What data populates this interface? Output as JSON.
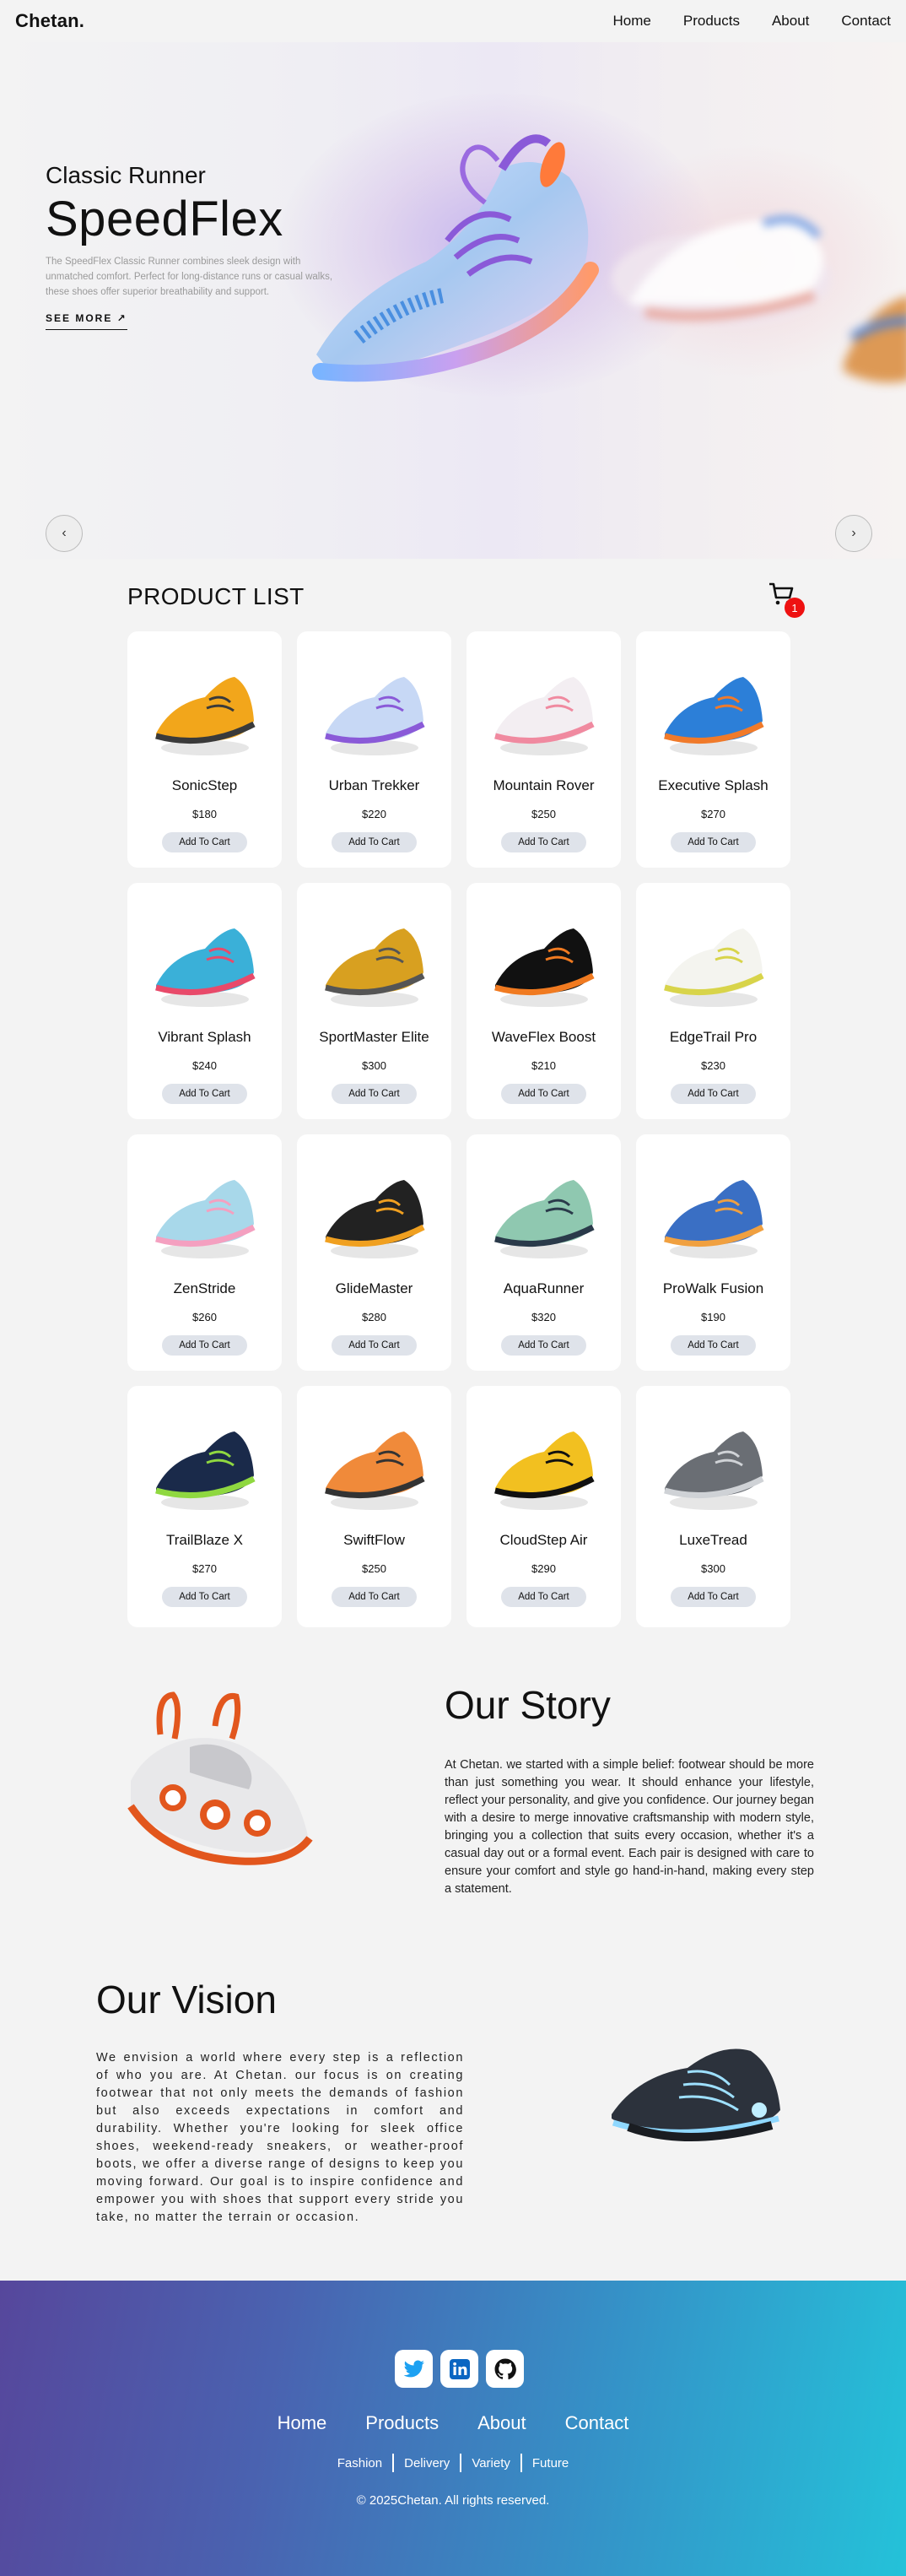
{
  "header": {
    "brand": "Chetan.",
    "nav": [
      "Home",
      "Products",
      "About",
      "Contact"
    ]
  },
  "hero": {
    "subtitle": "Classic Runner",
    "title": "SpeedFlex",
    "description": "The SpeedFlex Classic Runner combines sleek design with unmatched comfort. Perfect for long-distance runs or casual walks, these shoes offer superior breathability and support.",
    "cta": "SEE MORE ↗",
    "prev_icon": "‹",
    "next_icon": "›"
  },
  "product_list": {
    "title": "PRODUCT LIST",
    "cart_count": "1",
    "button_label": "Add To Cart",
    "products": [
      {
        "name": "SonicStep",
        "price": "$180"
      },
      {
        "name": "Urban Trekker",
        "price": "$220"
      },
      {
        "name": "Mountain Rover",
        "price": "$250"
      },
      {
        "name": "Executive Splash",
        "price": "$270"
      },
      {
        "name": "Vibrant Splash",
        "price": "$240"
      },
      {
        "name": "SportMaster Elite",
        "price": "$300"
      },
      {
        "name": "WaveFlex Boost",
        "price": "$210"
      },
      {
        "name": "EdgeTrail Pro",
        "price": "$230"
      },
      {
        "name": "ZenStride",
        "price": "$260"
      },
      {
        "name": "GlideMaster",
        "price": "$280"
      },
      {
        "name": "AquaRunner",
        "price": "$320"
      },
      {
        "name": "ProWalk Fusion",
        "price": "$190"
      },
      {
        "name": "TrailBlaze X",
        "price": "$270"
      },
      {
        "name": "SwiftFlow",
        "price": "$250"
      },
      {
        "name": "CloudStep Air",
        "price": "$290"
      },
      {
        "name": "LuxeTread",
        "price": "$300"
      }
    ]
  },
  "story": {
    "title": "Our Story",
    "text": "At Chetan. we started with a simple belief: footwear should be more than just something you wear. It should enhance your lifestyle, reflect your personality, and give you confidence. Our journey began with a desire to merge innovative craftsmanship with modern style, bringing you a collection that suits every occasion, whether it's a casual day out or a formal event. Each pair is designed with care to ensure your comfort and style go hand-in-hand, making every step a statement."
  },
  "vision": {
    "title": "Our Vision",
    "text": "We envision a world where every step is a reflection of who you are. At Chetan. our focus is on creating footwear that not only meets the demands of fashion but also exceeds expectations in comfort and durability. Whether you're looking for sleek office shoes, weekend-ready sneakers, or weather-proof boots, we offer a diverse range of designs to keep you moving forward. Our goal is to inspire confidence and empower you with shoes that support every stride you take, no matter the terrain or occasion."
  },
  "footer": {
    "socials": [
      "twitter-icon",
      "linkedin-icon",
      "github-icon"
    ],
    "nav": [
      "Home",
      "Products",
      "About",
      "Contact"
    ],
    "tags": [
      "Fashion",
      "Delivery",
      "Variety",
      "Future"
    ],
    "copyright": "© 2025Chetan. All rights reserved."
  },
  "colors": {
    "cart_badge": "#ee1111",
    "button_bg": "#dfe3ea",
    "footer_start": "#56479c",
    "footer_end": "#24c2d9"
  }
}
